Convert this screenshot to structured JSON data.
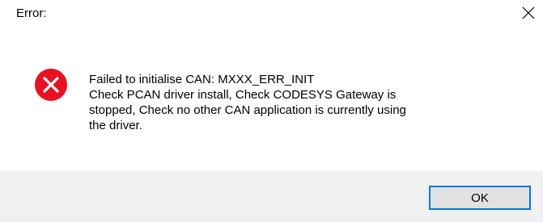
{
  "dialog": {
    "title": "Error:",
    "close_icon": "close-icon",
    "status_icon": "error-icon",
    "colors": {
      "error_red": "#e81123",
      "footer_bg": "#f0f0f0",
      "accent_border": "#0078d7",
      "button_bg": "#e1e1e1"
    },
    "message_lines": [
      "Failed to initialise CAN: MXXX_ERR_INIT",
      "Check PCAN driver install, Check CODESYS Gateway is",
      "stopped, Check no other CAN application is currently using",
      "the driver."
    ],
    "ok_label": "OK"
  }
}
